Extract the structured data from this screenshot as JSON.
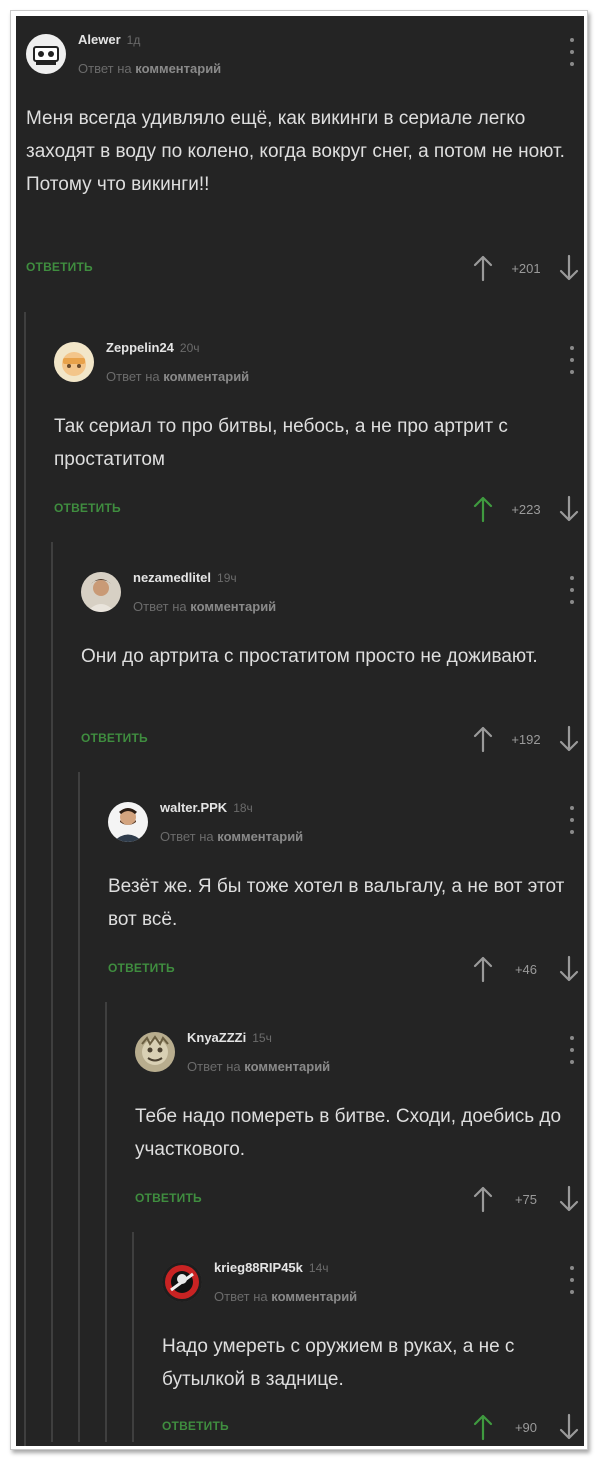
{
  "reply_prefix": "Ответ на",
  "reply_target": "комментарий",
  "reply_label": "ОТВЕТИТЬ",
  "accent_green": "#3f8d3f",
  "comments": [
    {
      "author": "Alewer",
      "time": "1д",
      "text": "Меня всегда удивляло ещё, как викинги в сериале легко заходят в воду по колено, когда вокруг снег, а потом не ноют.\nПотому что викинги!!",
      "score": "+201",
      "upvoted": false
    },
    {
      "author": "Zeppelin24",
      "time": "20ч",
      "text": "Так сериал то про битвы, небось, а не про артрит с простатитом",
      "score": "+223",
      "upvoted": true
    },
    {
      "author": "nezamedlitel",
      "time": "19ч",
      "text": "Они до артрита с простатитом просто не доживают.",
      "score": "+192",
      "upvoted": false
    },
    {
      "author": "walter.PPK",
      "time": "18ч",
      "text": "Везёт же. Я бы тоже хотел в вальгалу, а не вот этот вот всё.",
      "score": "+46",
      "upvoted": false
    },
    {
      "author": "KnyaZZZi",
      "time": "15ч",
      "text": "Тебе надо помереть в битве. Сходи, доебись до участкового.",
      "score": "+75",
      "upvoted": false
    },
    {
      "author": "krieg88RIP45k",
      "time": "14ч",
      "text": "Надо умереть с оружием в руках, а не с бутылкой в заднице.",
      "score": "+90",
      "upvoted": true
    }
  ]
}
